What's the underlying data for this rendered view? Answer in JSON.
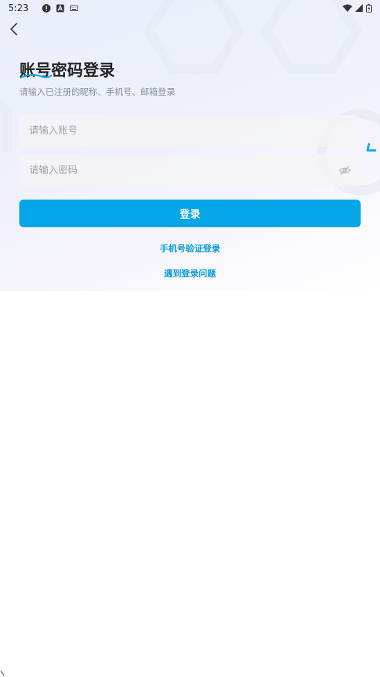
{
  "status_bar": {
    "time": "5:23"
  },
  "header": {
    "back_icon": "chevron-left-icon"
  },
  "login": {
    "title": "账号密码登录",
    "subtitle": "请输入已注册的昵称、手机号、邮箱登录",
    "account_placeholder": "请输入账号",
    "password_placeholder": "请输入密码",
    "login_button": "登录",
    "sms_login_link": "手机号验证登录",
    "login_problem_link": "遇到登录问题"
  },
  "colors": {
    "accent": "#05a6e8",
    "link": "#0a9bd8"
  }
}
